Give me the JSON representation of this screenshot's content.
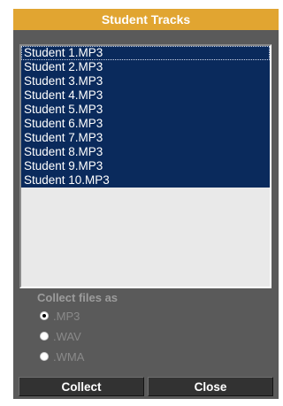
{
  "window": {
    "title": "Student Tracks"
  },
  "tracks": [
    {
      "label": "Student 1.MP3"
    },
    {
      "label": "Student 2.MP3"
    },
    {
      "label": "Student 3.MP3"
    },
    {
      "label": "Student 4.MP3"
    },
    {
      "label": "Student 5.MP3"
    },
    {
      "label": "Student 6.MP3"
    },
    {
      "label": "Student 7.MP3"
    },
    {
      "label": "Student 8.MP3"
    },
    {
      "label": "Student 9.MP3"
    },
    {
      "label": "Student 10.MP3"
    }
  ],
  "collect": {
    "label": "Collect files as",
    "options": [
      {
        "label": ".MP3",
        "checked": true
      },
      {
        "label": ".WAV",
        "checked": false
      },
      {
        "label": ".WMA",
        "checked": false
      }
    ]
  },
  "buttons": {
    "collect": "Collect",
    "close": "Close"
  },
  "colors": {
    "title_bar": "#e1a531",
    "dialog_bg": "#5a5a5a",
    "selection": "#0a2a5c",
    "list_bg": "#e9e9e9",
    "button_bg": "#323232"
  }
}
